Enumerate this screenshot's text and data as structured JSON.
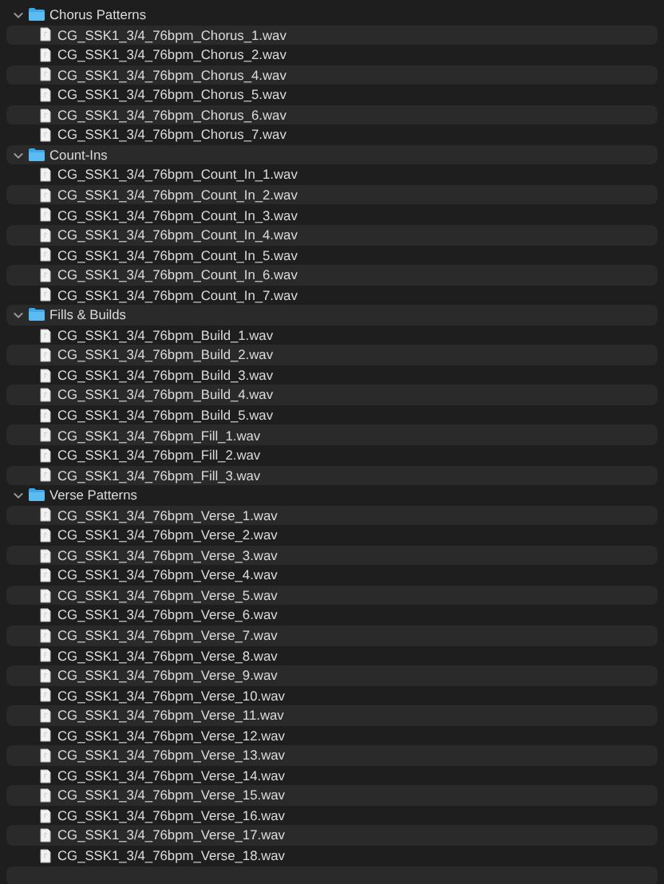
{
  "folders": [
    {
      "name": "Chorus Patterns",
      "expanded": true,
      "children": [
        "CG_SSK1_3/4_76bpm_Chorus_1.wav",
        "CG_SSK1_3/4_76bpm_Chorus_2.wav",
        "CG_SSK1_3/4_76bpm_Chorus_4.wav",
        "CG_SSK1_3/4_76bpm_Chorus_5.wav",
        "CG_SSK1_3/4_76bpm_Chorus_6.wav",
        "CG_SSK1_3/4_76bpm_Chorus_7.wav"
      ]
    },
    {
      "name": "Count-Ins",
      "expanded": true,
      "children": [
        "CG_SSK1_3/4_76bpm_Count_In_1.wav",
        "CG_SSK1_3/4_76bpm_Count_In_2.wav",
        "CG_SSK1_3/4_76bpm_Count_In_3.wav",
        "CG_SSK1_3/4_76bpm_Count_In_4.wav",
        "CG_SSK1_3/4_76bpm_Count_In_5.wav",
        "CG_SSK1_3/4_76bpm_Count_In_6.wav",
        "CG_SSK1_3/4_76bpm_Count_In_7.wav"
      ]
    },
    {
      "name": "Fills & Builds",
      "expanded": true,
      "children": [
        "CG_SSK1_3/4_76bpm_Build_1.wav",
        "CG_SSK1_3/4_76bpm_Build_2.wav",
        "CG_SSK1_3/4_76bpm_Build_3.wav",
        "CG_SSK1_3/4_76bpm_Build_4.wav",
        "CG_SSK1_3/4_76bpm_Build_5.wav",
        "CG_SSK1_3/4_76bpm_Fill_1.wav",
        "CG_SSK1_3/4_76bpm_Fill_2.wav",
        "CG_SSK1_3/4_76bpm_Fill_3.wav"
      ]
    },
    {
      "name": "Verse Patterns",
      "expanded": true,
      "children": [
        "CG_SSK1_3/4_76bpm_Verse_1.wav",
        "CG_SSK1_3/4_76bpm_Verse_2.wav",
        "CG_SSK1_3/4_76bpm_Verse_3.wav",
        "CG_SSK1_3/4_76bpm_Verse_4.wav",
        "CG_SSK1_3/4_76bpm_Verse_5.wav",
        "CG_SSK1_3/4_76bpm_Verse_6.wav",
        "CG_SSK1_3/4_76bpm_Verse_7.wav",
        "CG_SSK1_3/4_76bpm_Verse_8.wav",
        "CG_SSK1_3/4_76bpm_Verse_9.wav",
        "CG_SSK1_3/4_76bpm_Verse_10.wav",
        "CG_SSK1_3/4_76bpm_Verse_11.wav",
        "CG_SSK1_3/4_76bpm_Verse_12.wav",
        "CG_SSK1_3/4_76bpm_Verse_13.wav",
        "CG_SSK1_3/4_76bpm_Verse_14.wav",
        "CG_SSK1_3/4_76bpm_Verse_15.wav",
        "CG_SSK1_3/4_76bpm_Verse_16.wav",
        "CG_SSK1_3/4_76bpm_Verse_17.wav",
        "CG_SSK1_3/4_76bpm_Verse_18.wav"
      ]
    }
  ]
}
